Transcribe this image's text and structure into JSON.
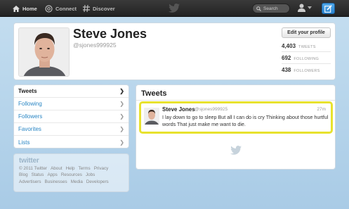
{
  "topbar": {
    "home_label": "Home",
    "connect_label": "Connect",
    "discover_label": "Discover",
    "search_placeholder": "Search"
  },
  "profile": {
    "name": "Steve Jones",
    "handle": "@sjones999925",
    "edit_button": "Edit your profile",
    "stats": [
      {
        "value": "4,403",
        "label": "TWEETS"
      },
      {
        "value": "692",
        "label": "FOLLOWING"
      },
      {
        "value": "438",
        "label": "FOLLOWERS"
      }
    ]
  },
  "sidebar": {
    "items": [
      {
        "label": "Tweets"
      },
      {
        "label": "Following"
      },
      {
        "label": "Followers"
      },
      {
        "label": "Favorites"
      },
      {
        "label": "Lists"
      }
    ]
  },
  "footer": {
    "logo": "twitter",
    "row1": [
      "© 2011 Twitter",
      "About",
      "Help",
      "Terms",
      "Privacy"
    ],
    "row2": [
      "Blog",
      "Status",
      "Apps",
      "Resources",
      "Jobs"
    ],
    "row3": [
      "Advertisers",
      "Businesses",
      "Media",
      "Developers"
    ]
  },
  "tweets": {
    "title": "Tweets",
    "items": [
      {
        "name": "Steve Jones",
        "handle": "@sjones999925",
        "time": "27m",
        "text": "I lay down to go to sleep But all I can do is cry Thinking about those hurtful words That just make me want to die."
      }
    ]
  },
  "colors": {
    "link": "#2a86c4",
    "highlight": "#e8e22e",
    "compose": "#2a84d0"
  }
}
